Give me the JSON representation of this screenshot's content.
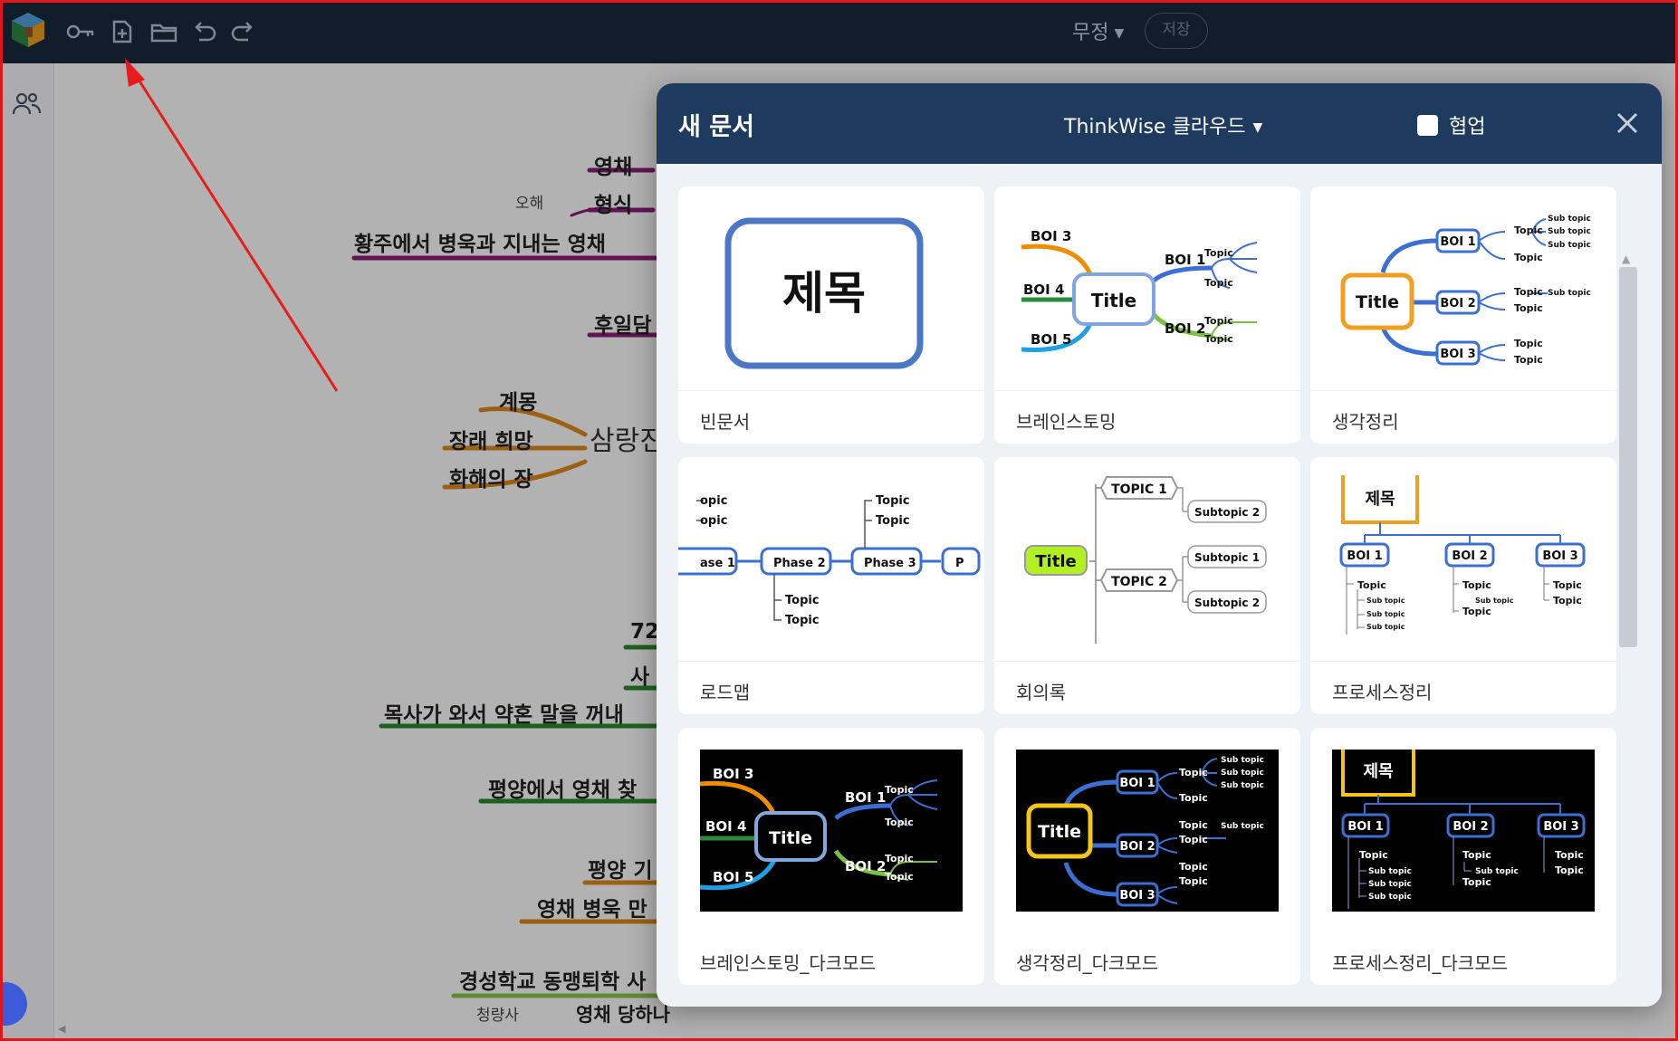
{
  "toolbar": {
    "doc_title": "무정",
    "save_label": "저장",
    "icons": [
      "app-logo-icon",
      "key-icon",
      "new-document-icon",
      "open-folder-icon",
      "undo-icon",
      "redo-icon"
    ]
  },
  "sidebar": {
    "icons": [
      "users-icon"
    ]
  },
  "mindmap": {
    "nodes": [
      "영채",
      "형식",
      "오해",
      "황주에서 병욱과 지내는 영채",
      "후일담",
      "계몽",
      "장래 희망",
      "화해의 장",
      "삼랑진",
      "72",
      "사",
      "목사가 와서 약혼 말을 꺼내",
      "평양에서 영채 찾",
      "평양 기",
      "영채 병욱 만",
      "경성학교 동맹퇴학 사",
      "청량사",
      "영채 당하나"
    ]
  },
  "dialog": {
    "title": "새 문서",
    "cloud_selector": "ThinkWise 클라우드",
    "collab_label": "협업",
    "colors": {
      "header": "#1f3a5f",
      "body": "#eef1f5"
    },
    "templates": [
      {
        "label": "빈문서",
        "thumb": {
          "title": "제목"
        }
      },
      {
        "label": "브레인스토밍",
        "thumb": {
          "title": "Title",
          "bois": [
            "BOI 3",
            "BOI 4",
            "BOI 5",
            "BOI 1",
            "BOI 2"
          ],
          "topic": "Topic"
        }
      },
      {
        "label": "생각정리",
        "thumb": {
          "title": "Title",
          "bois": [
            "BOI 1",
            "BOI 2",
            "BOI 3"
          ],
          "topic": "Topic",
          "sub": "Sub topic"
        }
      },
      {
        "label": "로드맵",
        "thumb": {
          "phases": [
            "ase 1",
            "Phase 2",
            "Phase 3",
            "P"
          ],
          "topic": "Topic",
          "topic_cut": "opic"
        }
      },
      {
        "label": "회의록",
        "thumb": {
          "title": "Title",
          "topics": [
            "TOPIC 1",
            "TOPIC 2"
          ],
          "subtopic": "Subtopic 2",
          "subtopic1": "Subtopic 1"
        }
      },
      {
        "label": "프로세스정리",
        "thumb": {
          "title": "제목",
          "bois": [
            "BOI 1",
            "BOI 2",
            "BOI 3"
          ],
          "topic": "Topic",
          "sub": "Sub topic"
        }
      },
      {
        "label": "브레인스토밍_다크모드",
        "thumb": {
          "title": "Title",
          "bois": [
            "BOI 3",
            "BOI 4",
            "BOI 5",
            "BOI 1",
            "BOI 2"
          ],
          "topic": "Topic"
        }
      },
      {
        "label": "생각정리_다크모드",
        "thumb": {
          "title": "Title",
          "bois": [
            "BOI 1",
            "BOI 2",
            "BOI 3"
          ],
          "topic": "Topic",
          "sub": "Sub topic"
        }
      },
      {
        "label": "프로세스정리_다크모드",
        "thumb": {
          "title": "제목",
          "bois": [
            "BOI 1",
            "BOI 2",
            "BOI 3"
          ],
          "topic": "Topic",
          "sub": "Sub topic"
        }
      }
    ]
  }
}
